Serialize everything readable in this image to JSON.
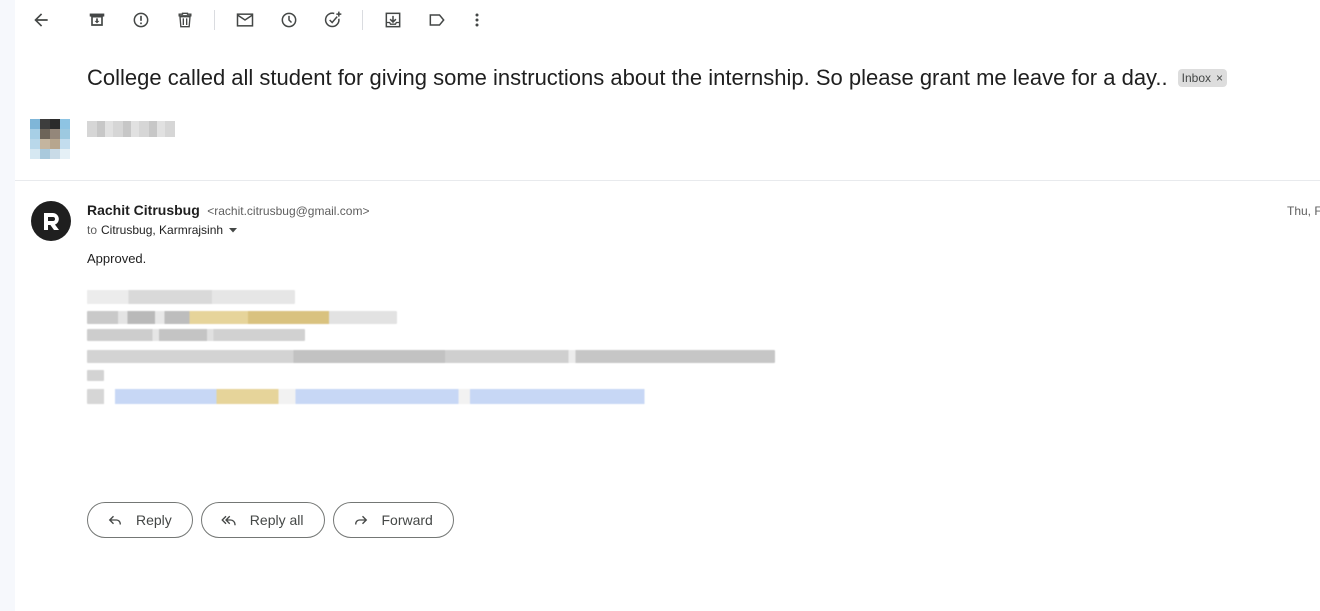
{
  "toolbar": {
    "icons": [
      "back-arrow-icon",
      "archive-icon",
      "report-spam-icon",
      "delete-icon",
      "mark-unread-icon",
      "snooze-icon",
      "add-to-tasks-icon",
      "move-to-icon",
      "label-icon",
      "more-vert-icon"
    ]
  },
  "thread": {
    "subject": "College called all student for giving some instructions about the internship. So please grant me leave for a day..",
    "label": "Inbox",
    "label_remove": "×"
  },
  "message": {
    "sender_name": "Rachit Citrusbug",
    "sender_email": "<rachit.citrusbug@gmail.com>",
    "to_prefix": "to",
    "recipients": "Citrusbug, Karmrajsinh",
    "date": "Thu, F",
    "body": "Approved."
  },
  "actions": {
    "reply": "Reply",
    "reply_all": "Reply all",
    "forward": "Forward"
  },
  "colors": {
    "background": "#f6f8fc",
    "panel": "#ffffff",
    "chip": "#dddddd",
    "button_border": "#747775",
    "link_blur": "#c7d7f5",
    "highlight_blur": "#e6d49a"
  }
}
